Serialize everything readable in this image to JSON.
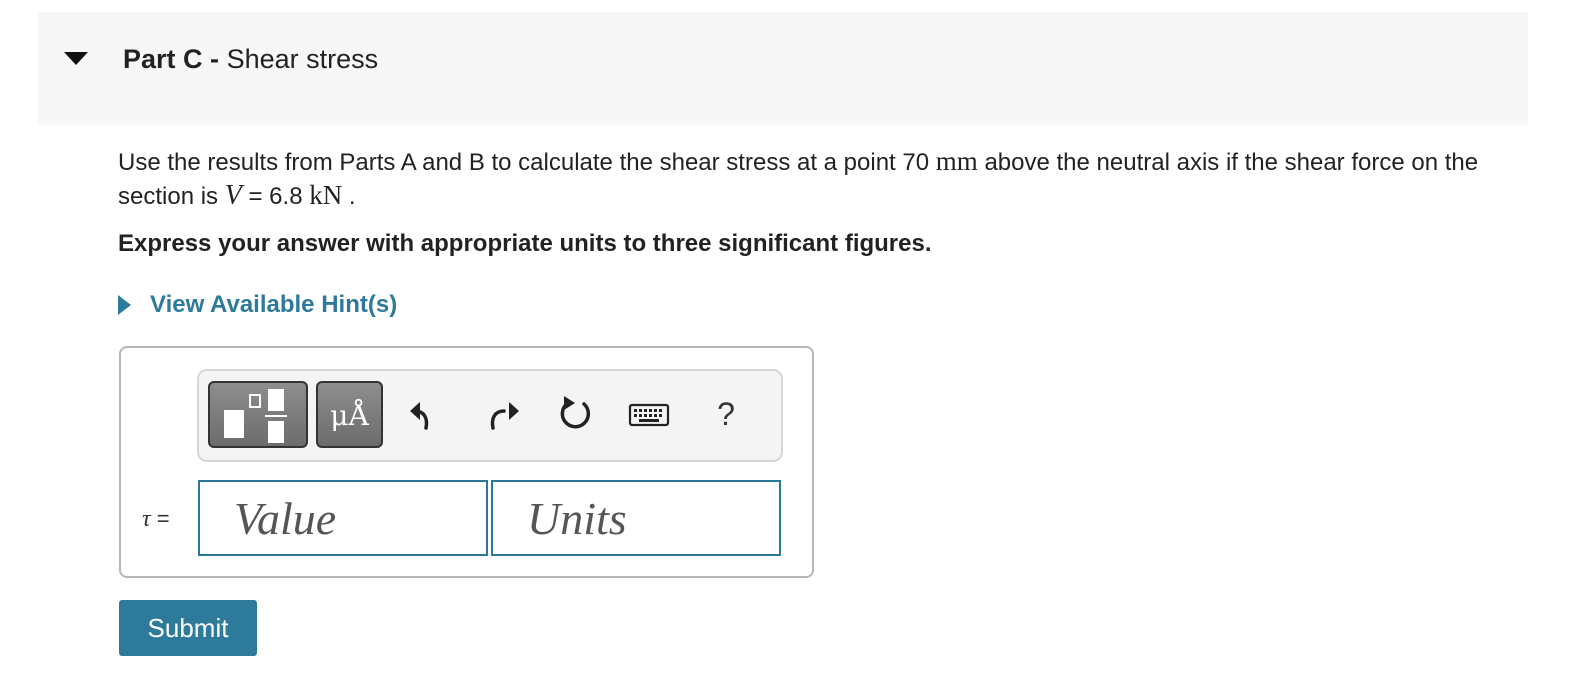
{
  "part": {
    "label": "Part C",
    "separator": "-",
    "title": "Shear stress"
  },
  "question": {
    "text1": "Use the results from Parts A and B to calculate the shear stress at a point 70",
    "unit_mm": "mm",
    "text2": "above the neutral axis if the shear force on the section is",
    "var_v": "V",
    "eq_value": "= 6.8",
    "unit_kn": "kN",
    "period": "."
  },
  "instruction": "Express your answer with appropriate units to three significant figures.",
  "hints": {
    "label": "View Available Hint(s)"
  },
  "toolbar": {
    "symbols_label": "μÅ",
    "help_label": "?",
    "icons": [
      "templates-icon",
      "symbols-icon",
      "undo-icon",
      "redo-icon",
      "reset-icon",
      "keyboard-icon",
      "help-icon"
    ]
  },
  "answer": {
    "variable": "τ",
    "equals": "=",
    "value_placeholder": "Value",
    "units_placeholder": "Units"
  },
  "submit_label": "Submit",
  "colors": {
    "accent": "#2e7a9a",
    "header_bg": "#f7f7f7",
    "toolbar_button": "#7a7a7a"
  }
}
